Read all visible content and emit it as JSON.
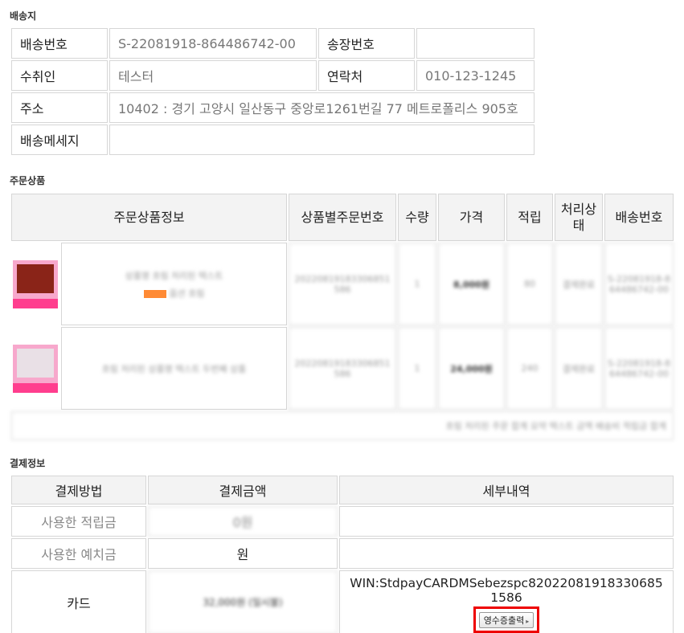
{
  "shipping": {
    "title": "배송지",
    "delivery_no_label": "배송번호",
    "delivery_no": "S-22081918-864486742-00",
    "invoice_label": "송장번호",
    "invoice_value": "",
    "recipient_label": "수취인",
    "recipient": "테스터",
    "contact_label": "연락처",
    "contact": "010-123-1245",
    "address_label": "주소",
    "address": "10402 : 경기 고양시 일산동구 중앙로1261번길 77 메트로폴리스 905호",
    "message_label": "배송메세지",
    "message": ""
  },
  "order": {
    "title": "주문상품",
    "headers": {
      "product_info": "주문상품정보",
      "order_no": "상품별주문번호",
      "qty": "수량",
      "price": "가격",
      "points": "적립",
      "status": "처리상태",
      "delivery_no": "배송번호"
    },
    "rows": [
      {
        "name": "상품명 흐림 처리된 텍스트",
        "option": "옵션 흐림",
        "order_no": "20220819183306851586",
        "qty": "1",
        "price": "8,000원",
        "points": "80",
        "status": "결제완료",
        "delivery_no": "S-22081918-864486742-00"
      },
      {
        "name": "흐림 처리된 상품명 텍스트 두번째 상품",
        "option": "",
        "order_no": "20220819183306851586",
        "qty": "1",
        "price": "24,000원",
        "points": "240",
        "status": "결제완료",
        "delivery_no": "S-22081918-864486742-00"
      }
    ],
    "summary": "흐림 처리된 주문 합계 요약 텍스트 금액 배송비 적립금 합계"
  },
  "payment": {
    "title": "결제정보",
    "headers": {
      "method": "결제방법",
      "amount": "결제금액",
      "detail": "세부내역"
    },
    "rows": [
      {
        "method": "사용한 적립금",
        "amount": "0원",
        "detail": ""
      },
      {
        "method": "사용한 예치금",
        "amount": "원",
        "detail": ""
      }
    ],
    "card": {
      "method": "카드",
      "amount": "32,000원 (일시불)",
      "detail": "WIN:StdpayCARDMSebezspc82022081918330685 1586",
      "receipt_button": "영수증출력"
    }
  },
  "colors": {
    "highlight": "#ee0000",
    "thumb_strip": "#ff3e8e"
  }
}
